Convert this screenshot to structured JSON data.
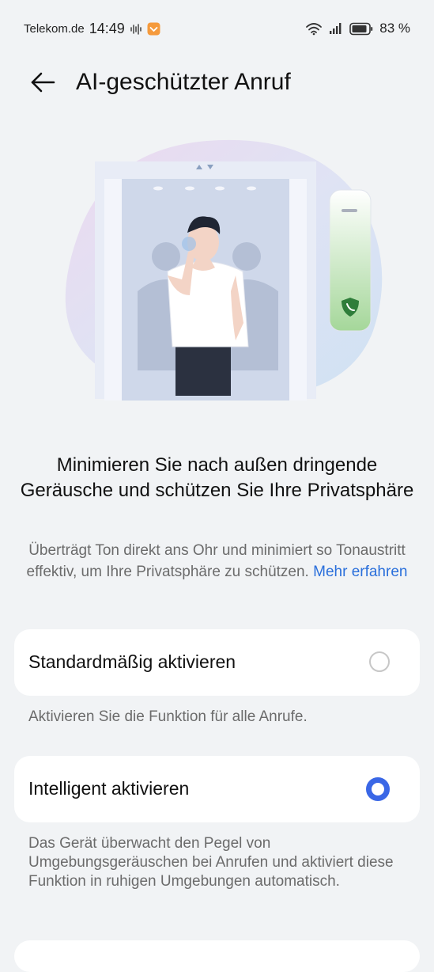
{
  "status_bar": {
    "carrier": "Telekom.de",
    "time": "14:49",
    "battery": "83 %"
  },
  "header": {
    "title": "AI-geschützter Anruf"
  },
  "description": {
    "headline": "Minimieren Sie nach außen dringende Geräusche und schützen Sie Ihre Privatsphäre",
    "body": "Überträgt Ton direkt ans Ohr und minimiert so Tonaustritt effektiv, um Ihre Privatsphäre zu schützen.",
    "learn_more": "Mehr erfahren"
  },
  "options": [
    {
      "label": "Standardmäßig aktivieren",
      "selected": false,
      "description": "Aktivieren Sie die Funktion für alle Anrufe."
    },
    {
      "label": "Intelligent aktivieren",
      "selected": true,
      "description": "Das Gerät überwacht den Pegel von Umgebungsgeräuschen bei Anrufen und aktiviert diese Funktion in ruhigen Umgebungen automatisch."
    }
  ],
  "colors": {
    "accent": "#3a67e6",
    "link": "#2a6fdb",
    "background": "#f1f3f5"
  }
}
